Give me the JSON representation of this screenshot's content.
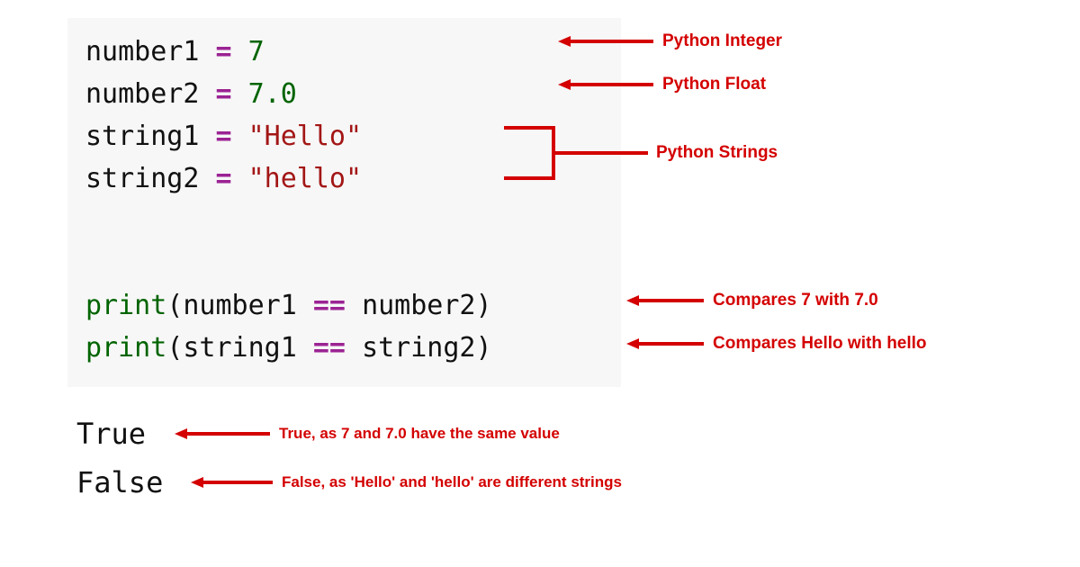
{
  "code": {
    "line1": {
      "var": "number1",
      "op": " = ",
      "val": "7"
    },
    "line2": {
      "var": "number2",
      "op": " = ",
      "val": "7.0"
    },
    "line3": {
      "var": "string1",
      "op": " = ",
      "val": "\"Hello\""
    },
    "line4": {
      "var": "string2",
      "op": " = ",
      "val": "\"hello\""
    },
    "line6": {
      "fn": "print",
      "open": "(",
      "a": "number1",
      "cmp": " == ",
      "b": "number2",
      "close": ")"
    },
    "line7": {
      "fn": "print",
      "open": "(",
      "a": "string1",
      "cmp": " == ",
      "b": "string2",
      "close": ")"
    }
  },
  "output": {
    "line1": "True",
    "line2": "False"
  },
  "annotations": {
    "a1": "Python Integer",
    "a2": "Python Float",
    "a3": "Python Strings",
    "a4": "Compares 7 with 7.0",
    "a5": "Compares Hello with hello",
    "a6": "True, as 7 and 7.0 have the same value",
    "a7": "False, as 'Hello' and 'hello' are different strings"
  }
}
